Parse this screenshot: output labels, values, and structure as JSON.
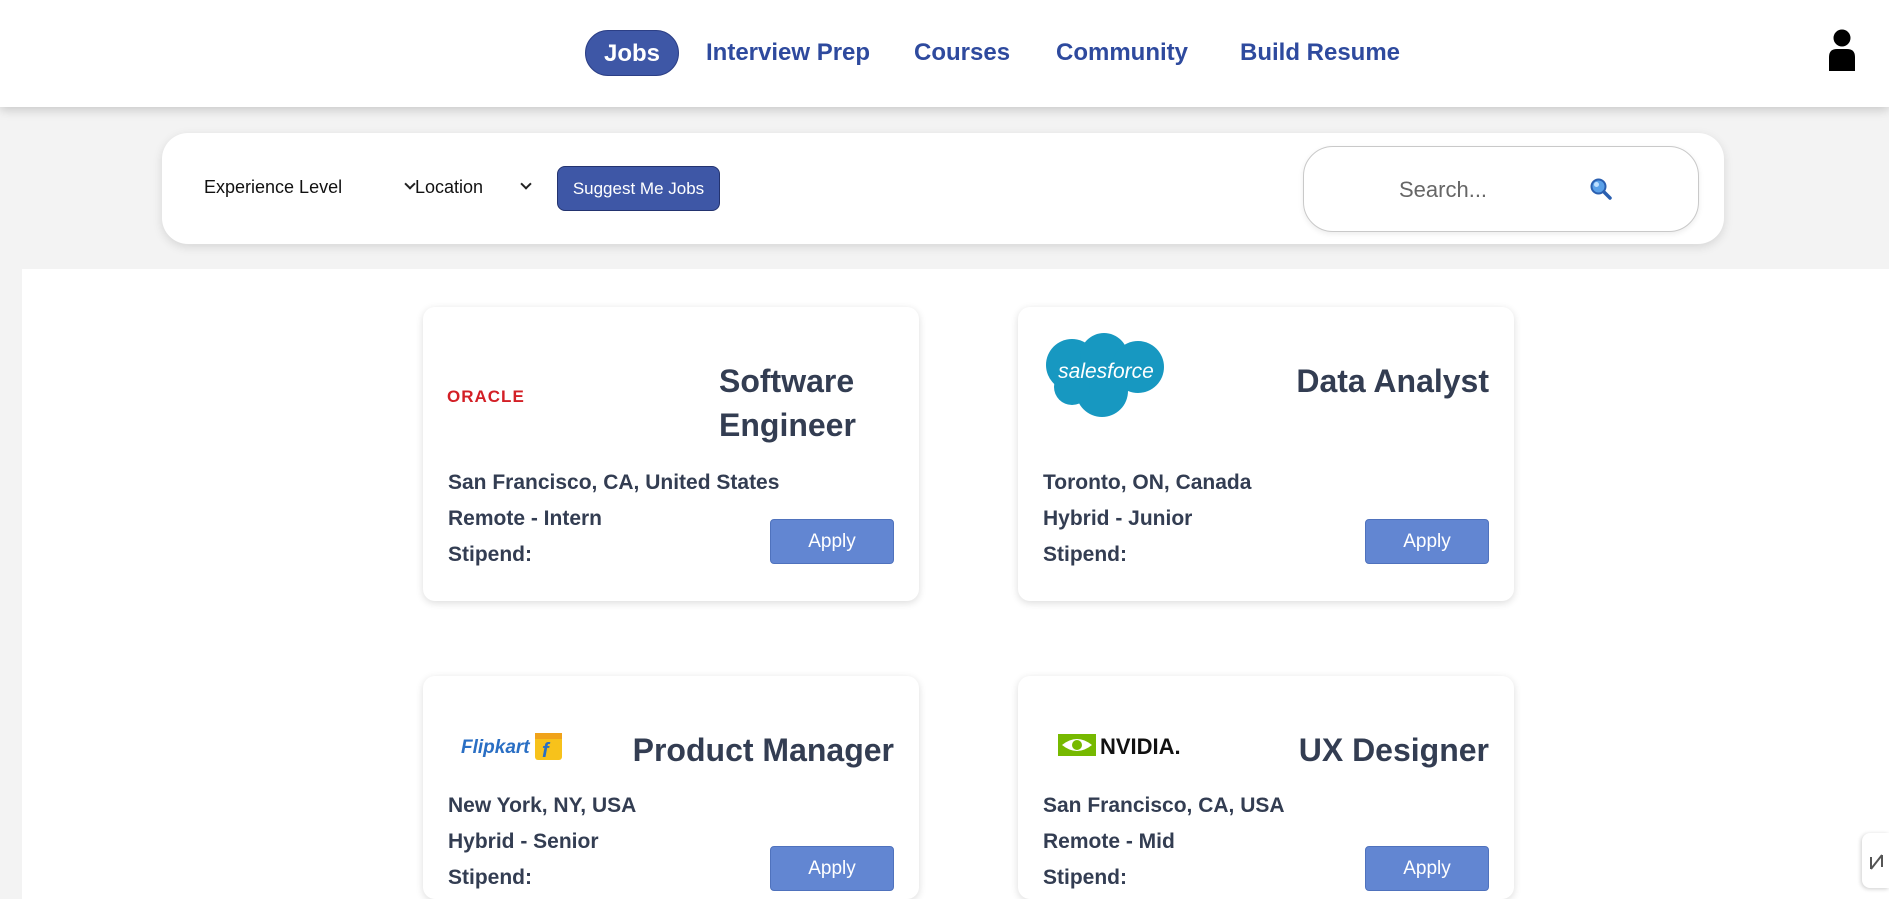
{
  "nav": {
    "links": [
      "Jobs",
      "Interview Prep",
      "Courses",
      "Community",
      "Build Resume"
    ],
    "active": "Jobs",
    "user_icon": "user-icon",
    "colors": {
      "accent": "#3e57a6",
      "link": "#2e4a9e"
    }
  },
  "filters": {
    "experience_label": "Experience Level",
    "location_label": "Location",
    "suggest_label": "Suggest Me Jobs",
    "search_placeholder": "Search...",
    "search_icon": "magnifier-icon"
  },
  "jobs": [
    {
      "company": "ORACLE",
      "title": "Software Engineer",
      "location": "San Francisco, CA, United States",
      "mode": "Remote - Intern",
      "stipend": "Stipend:",
      "apply_label": "Apply"
    },
    {
      "company": "salesforce",
      "title": "Data Analyst",
      "location": "Toronto, ON, Canada",
      "mode": "Hybrid - Junior",
      "stipend": "Stipend:",
      "apply_label": "Apply"
    },
    {
      "company": "Flipkart",
      "title": "Product Manager",
      "location": "New York, NY, USA",
      "mode": "Hybrid - Senior",
      "stipend": "Stipend:",
      "apply_label": "Apply"
    },
    {
      "company": "NVIDIA",
      "title": "UX Designer",
      "location": "San Francisco, CA, USA",
      "mode": "Remote - Mid",
      "stipend": "Stipend:",
      "apply_label": "Apply"
    }
  ],
  "colors": {
    "apply": "#6286d2",
    "text": "#333d52",
    "background": "#f3f3f3"
  }
}
